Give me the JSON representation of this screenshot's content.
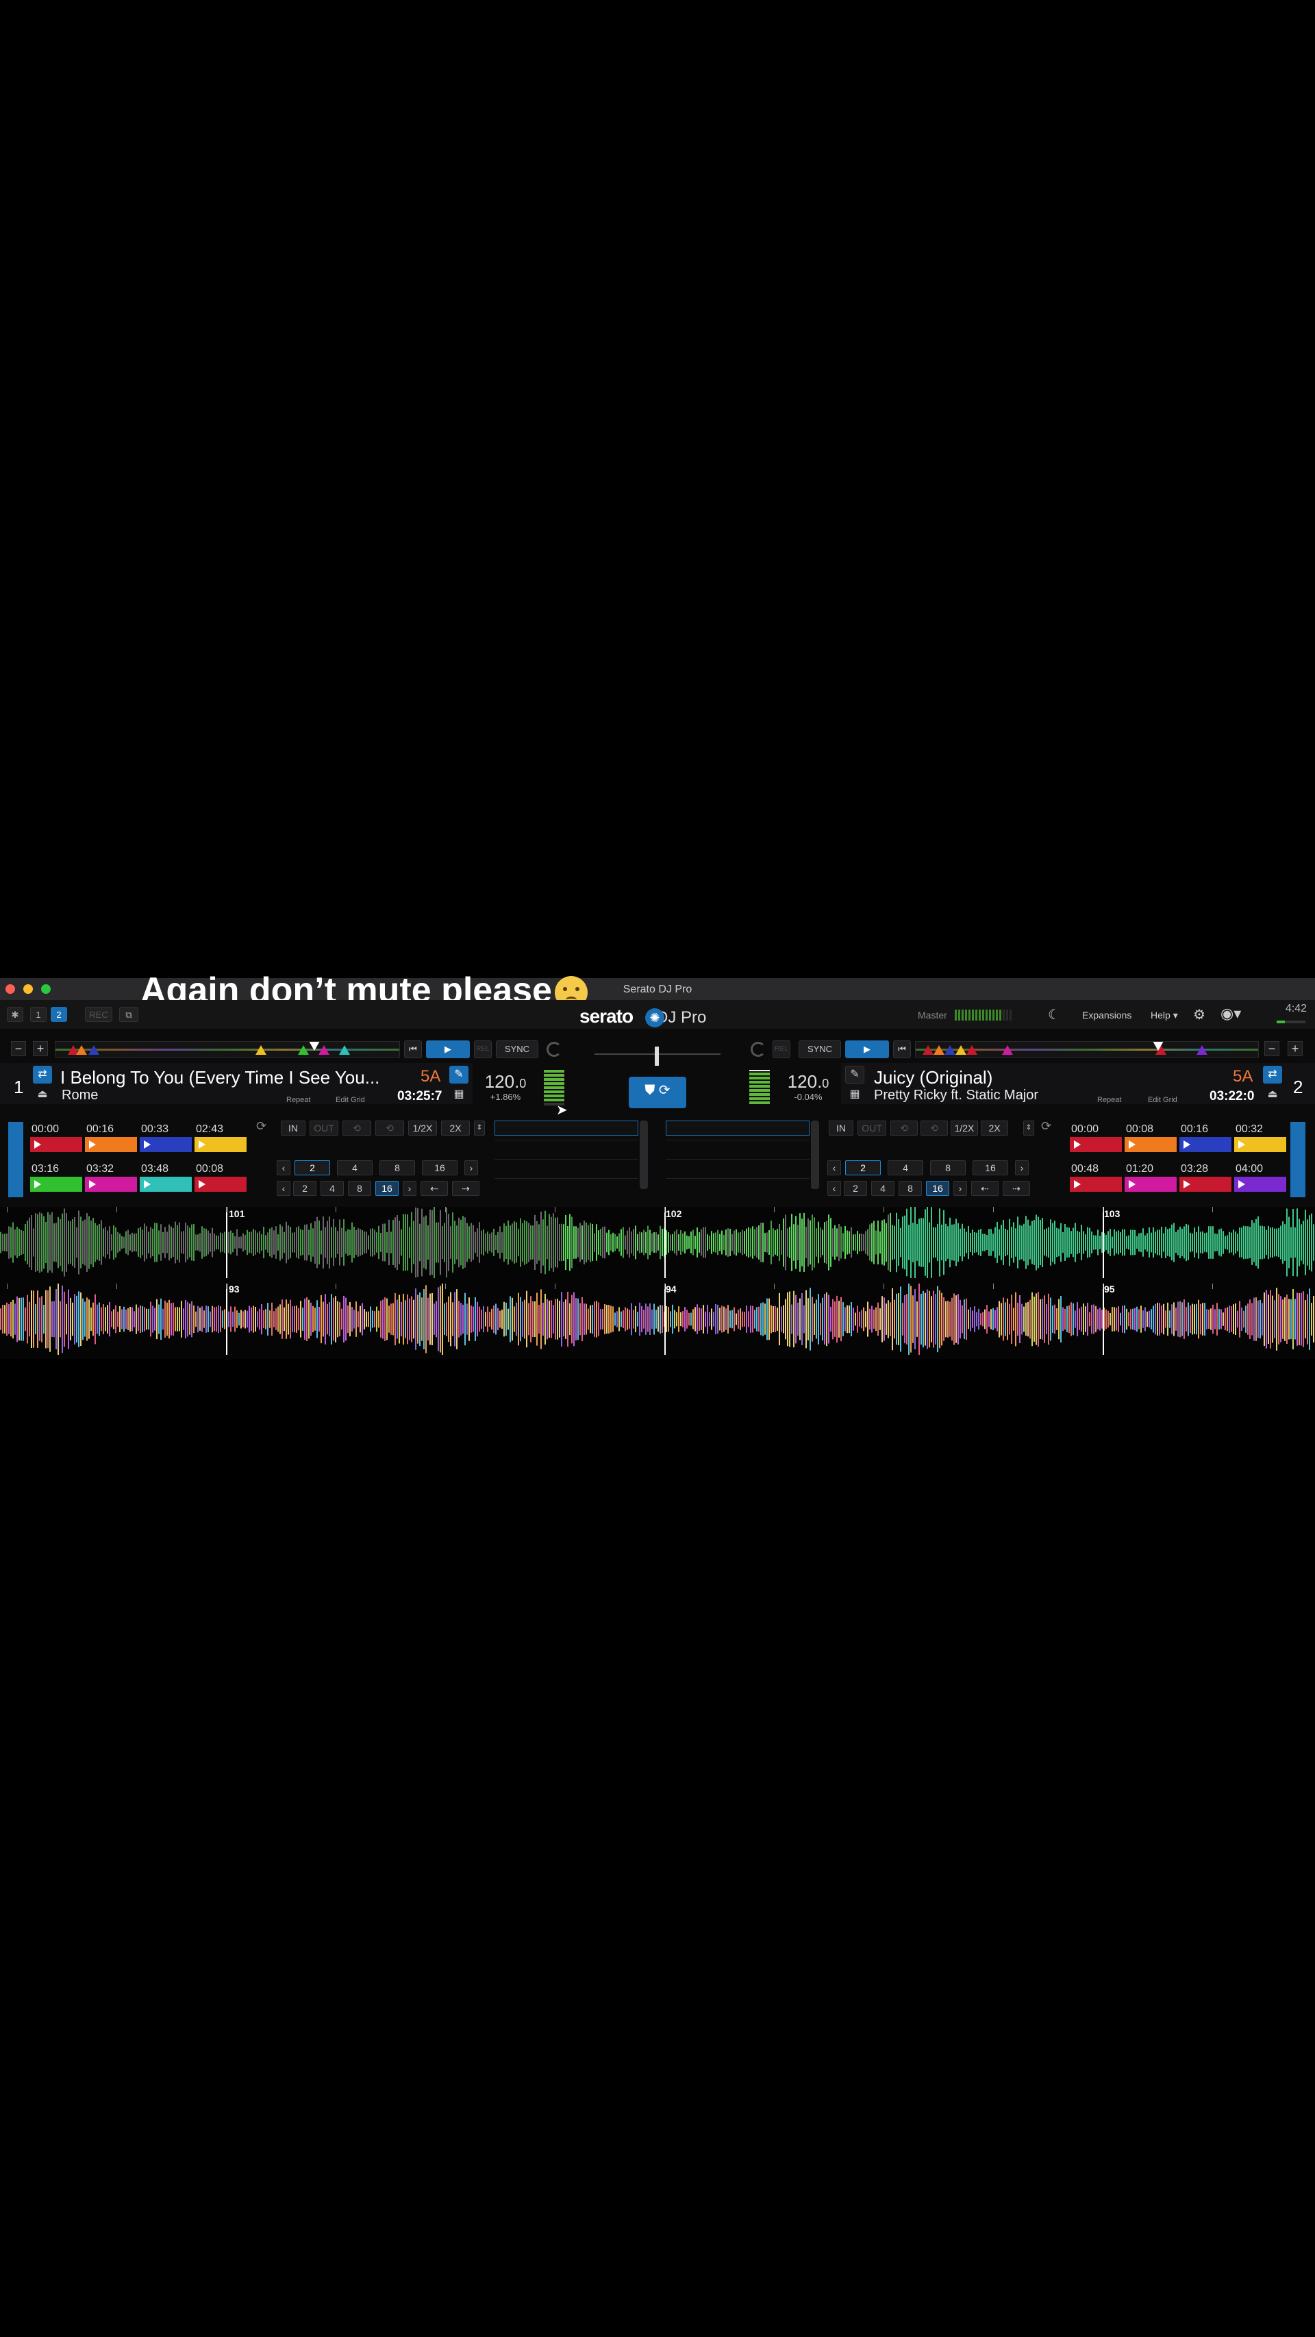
{
  "window": {
    "title": "Serato DJ Pro"
  },
  "overlay_caption": "Again don’t mute please",
  "toolbar": {
    "deck_buttons": [
      "1",
      "2"
    ],
    "rec_label": "REC",
    "logo": "serato",
    "logo_sub": "DJ Pro",
    "master_label": "Master",
    "expansions_label": "Expansions",
    "help_label": "Help",
    "clock": "4:42"
  },
  "deck1": {
    "number": "1",
    "title": "I Belong To You (Every Time I See You...",
    "artist": "Rome",
    "key": "5A",
    "time": "03:25:7",
    "repeat_label": "Repeat",
    "edit_grid_label": "Edit Grid",
    "bpm_main": "120.",
    "bpm_dec": "0",
    "pitch": "+1.86%",
    "sync_label": "SYNC",
    "rel_label": "REL",
    "minus": "−",
    "plus": "+",
    "cues": [
      {
        "time": "00:00",
        "color": "#c81a2e"
      },
      {
        "time": "00:16",
        "color": "#f07a1e"
      },
      {
        "time": "00:33",
        "color": "#2a3fc0"
      },
      {
        "time": "02:43",
        "color": "#f0c020"
      },
      {
        "time": "03:16",
        "color": "#30c030"
      },
      {
        "time": "03:32",
        "color": "#d01aa0"
      },
      {
        "time": "03:48",
        "color": "#30c0b8"
      },
      {
        "time": "00:08",
        "color": "#c81a2e"
      }
    ],
    "loop": {
      "in": "IN",
      "out": "OUT",
      "half": "1/2X",
      "double": "2X",
      "autoloop": [
        "2",
        "4",
        "8",
        "16"
      ],
      "beatjump": [
        "2",
        "4",
        "8",
        "16"
      ],
      "selected_autoloop": "2",
      "selected_beatjump": "16"
    }
  },
  "deck2": {
    "number": "2",
    "title": "Juicy (Original)",
    "artist": "Pretty Ricky ft. Static Major",
    "key": "5A",
    "time": "03:22:0",
    "repeat_label": "Repeat",
    "edit_grid_label": "Edit Grid",
    "bpm_main": "120.",
    "bpm_dec": "0",
    "pitch": "-0.04%",
    "sync_label": "SYNC",
    "rel_label": "REL",
    "minus": "−",
    "plus": "+",
    "cues": [
      {
        "time": "00:00",
        "color": "#c81a2e"
      },
      {
        "time": "00:08",
        "color": "#f07a1e"
      },
      {
        "time": "00:16",
        "color": "#2a3fc0"
      },
      {
        "time": "00:32",
        "color": "#f0c020"
      },
      {
        "time": "00:48",
        "color": "#c81a2e"
      },
      {
        "time": "01:20",
        "color": "#d01aa0"
      },
      {
        "time": "03:28",
        "color": "#c81a2e"
      },
      {
        "time": "04:00",
        "color": "#7a2ad0"
      }
    ],
    "loop": {
      "in": "IN",
      "out": "OUT",
      "half": "1/2X",
      "double": "2X",
      "autoloop": [
        "2",
        "4",
        "8",
        "16"
      ],
      "beatjump": [
        "2",
        "4",
        "8",
        "16"
      ],
      "selected_autoloop": "2",
      "selected_beatjump": "16"
    }
  },
  "waveform": {
    "deck1_bars": [
      "101",
      "102",
      "103"
    ],
    "deck2_bars": [
      "93",
      "94",
      "95"
    ]
  },
  "colors": {
    "accent": "#1a6fb5",
    "key": "#f07a3a",
    "deck1_wave": "#3fbf4a",
    "background": "#0b0b0c"
  }
}
